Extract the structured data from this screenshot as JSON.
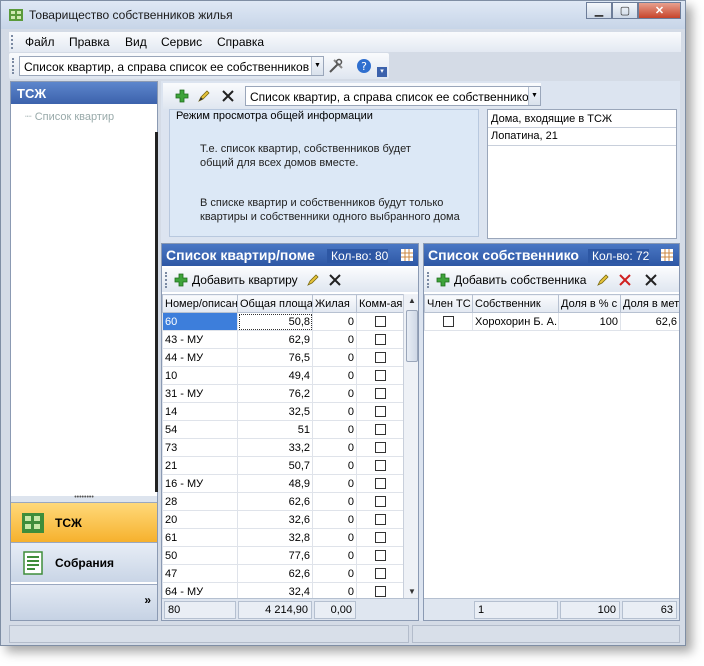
{
  "window": {
    "title": "Товарищество собственников жилья"
  },
  "menu": [
    "Файл",
    "Правка",
    "Вид",
    "Сервис",
    "Справка"
  ],
  "top_combo": {
    "value": "Список квартир, а справа список ее собственников"
  },
  "sidebar": {
    "header": "ТСЖ",
    "tree_item": "Список квартир",
    "nav": [
      {
        "label": "ТСЖ",
        "active": true
      },
      {
        "label": "Собрания",
        "active": false
      }
    ],
    "more": "»"
  },
  "inner_combo": {
    "value": "Список квартир, а справа список ее собственников"
  },
  "info": {
    "legend": "Режим просмотра общей информации",
    "p1": [
      "Т.е. список квартир, собственников будет",
      "общий для всех домов вместе."
    ],
    "p2": [
      "В списке квартир и собственников будут только",
      "квартиры и собственники одного выбранного дома"
    ]
  },
  "houses": {
    "header": "Дома, входящие в ТСЖ",
    "rows": [
      "Лопатина, 21"
    ]
  },
  "apartments": {
    "title": "Список квартир/поме",
    "count_label": "Кол-во: 80",
    "add_label": "Добавить квартиру",
    "columns": [
      "Номер/описан",
      "Общая площа",
      "Жилая",
      "Комм-ая"
    ],
    "rows": [
      [
        "60",
        "50,8",
        "0"
      ],
      [
        "43 - МУ",
        "62,9",
        "0"
      ],
      [
        "44 - МУ",
        "76,5",
        "0"
      ],
      [
        "10",
        "49,4",
        "0"
      ],
      [
        "31 - МУ",
        "76,2",
        "0"
      ],
      [
        "14",
        "32,5",
        "0"
      ],
      [
        "54",
        "51",
        "0"
      ],
      [
        "73",
        "33,2",
        "0"
      ],
      [
        "21",
        "50,7",
        "0"
      ],
      [
        "16 - МУ",
        "48,9",
        "0"
      ],
      [
        "28",
        "62,6",
        "0"
      ],
      [
        "20",
        "32,6",
        "0"
      ],
      [
        "61",
        "32,8",
        "0"
      ],
      [
        "50",
        "77,6",
        "0"
      ],
      [
        "47",
        "62,6",
        "0"
      ],
      [
        "64 - МУ",
        "32,4",
        "0"
      ]
    ],
    "footer": [
      "80",
      "4 214,90",
      "0,00"
    ]
  },
  "owners": {
    "title": "Список собственнико",
    "count_label": "Кол-во: 72",
    "add_label": "Добавить собственника",
    "columns": [
      "Член ТС",
      "Собственник",
      "Доля в % с",
      "Доля в мет"
    ],
    "rows": [
      [
        "Хорохорин Б. А.",
        "100",
        "62,6"
      ]
    ],
    "footer": [
      "1",
      "100",
      "63"
    ]
  },
  "colors": {
    "header_blue": "#2d57a4",
    "active_nav": "#f6b12d",
    "selection": "#3d7edb"
  }
}
